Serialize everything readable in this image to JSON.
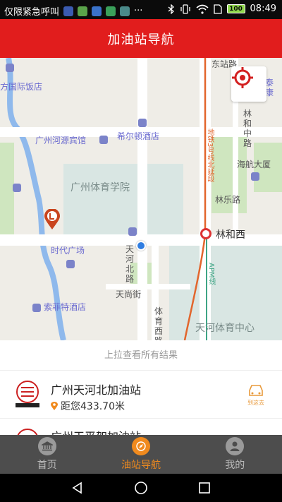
{
  "status_bar": {
    "left_text": "仅限紧急呼叫",
    "more": "···",
    "time": "08:49",
    "battery": "100"
  },
  "header": {
    "title": "加油站导航"
  },
  "map": {
    "labels": {
      "hotel_top": "方国际饭店",
      "heyuan_hotel": "广州河源宾馆",
      "hilton": "希尔顿酒店",
      "sports_institute": "广州体育学院",
      "times_square": "时代广场",
      "sofitel": "索菲特酒店",
      "tianhe_north_1": "天",
      "tianhe_north_2": "河",
      "tianhe_north_3": "北",
      "tianhe_north_4": "路",
      "tianshang": "天尚街",
      "tiyu_west_1": "体",
      "tiyu_west_2": "育",
      "tiyu_west_3": "西",
      "tiyu_west_4": "路",
      "sports_center": "天河体育中心",
      "linhe_west": "林和西",
      "linle": "林乐路",
      "haihang": "海航大厦",
      "linhezhong_1": "林",
      "linhezhong_2": "和",
      "linhezhong_3": "中",
      "linhezhong_4": "路",
      "tai": "泰",
      "kang": "康",
      "dongzhan": "东站路",
      "metro_line": "地铁3号线北延段",
      "apm_line": "APM线"
    }
  },
  "sheet": {
    "pull_hint": "上拉查看所有结果",
    "stations": [
      {
        "name": "广州天河北加油站",
        "distance": "距您433.70米",
        "nav_label": "到这去"
      },
      {
        "name": "广州天平架加油站"
      }
    ]
  },
  "tabs": [
    {
      "label": "首页",
      "icon": "bank-icon"
    },
    {
      "label": "油站导航",
      "icon": "compass-icon"
    },
    {
      "label": "我的",
      "icon": "user-icon"
    }
  ],
  "colors": {
    "brand": "#e11d1d",
    "accent": "#f08a1e",
    "tabbar": "#4d4d4d"
  }
}
